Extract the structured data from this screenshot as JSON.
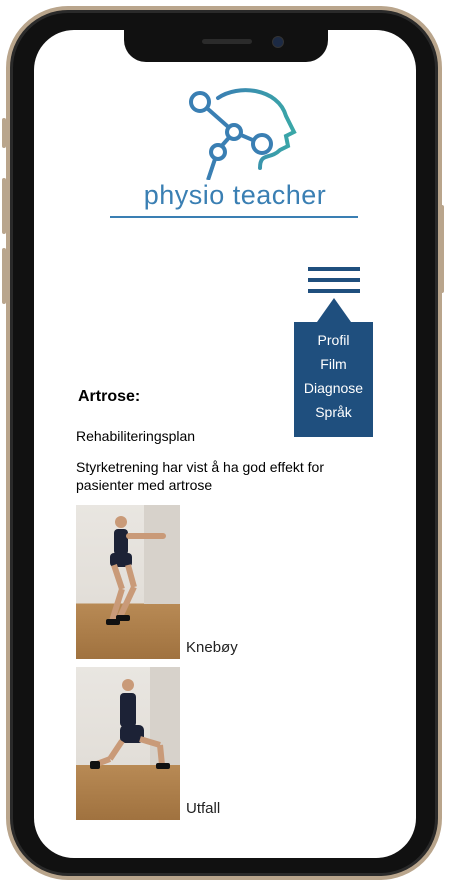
{
  "app": {
    "brand": "physio teacher"
  },
  "menu": {
    "icon": "hamburger-menu-icon",
    "items": [
      "Profil",
      "Film",
      "Diagnose",
      "Språk"
    ]
  },
  "content": {
    "title": "Artrose:",
    "subtitle": "Rehabiliteringsplan",
    "description": "Styrketrening har vist å ha god effekt for pasienter med artrose",
    "exercises": [
      {
        "name": "Knebøy"
      },
      {
        "name": "Utfall"
      }
    ]
  },
  "colors": {
    "brand_blue": "#3a7fb3",
    "menu_bg": "#1f4f7e"
  }
}
